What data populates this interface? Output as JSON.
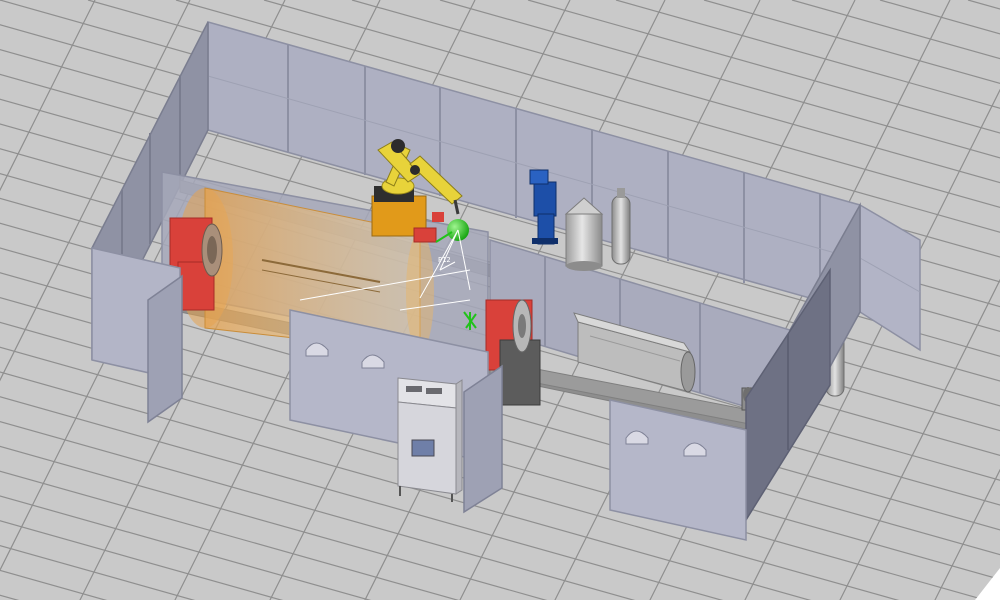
{
  "viewport": {
    "title": "",
    "background": "#c9c9c9",
    "grid_color": "#8f8f8f"
  },
  "scene": {
    "fence_fill": "#a9abbd",
    "fence_frame": "#8d90a3",
    "robot_color": "#e8d33a",
    "robot_base_color": "#e19a1a",
    "positioner_color": "#d9413a",
    "tcp_marker_color": "#21c21a",
    "workpiece_color": "#e2a858",
    "rail_color": "#8e8e8e",
    "tank_color": "#b9b9b9",
    "wire_feeder_color": "#1d4fa8",
    "control_cabinet_color": "#d8d8dc",
    "markers": {
      "p12": "P12"
    }
  },
  "icons": {
    "tcp_marker": "green-sphere-icon",
    "wire_feeder": "wire-feeder-icon",
    "gas_cylinder": "gas-cylinder-icon",
    "control_cabinet": "control-cabinet-icon"
  }
}
